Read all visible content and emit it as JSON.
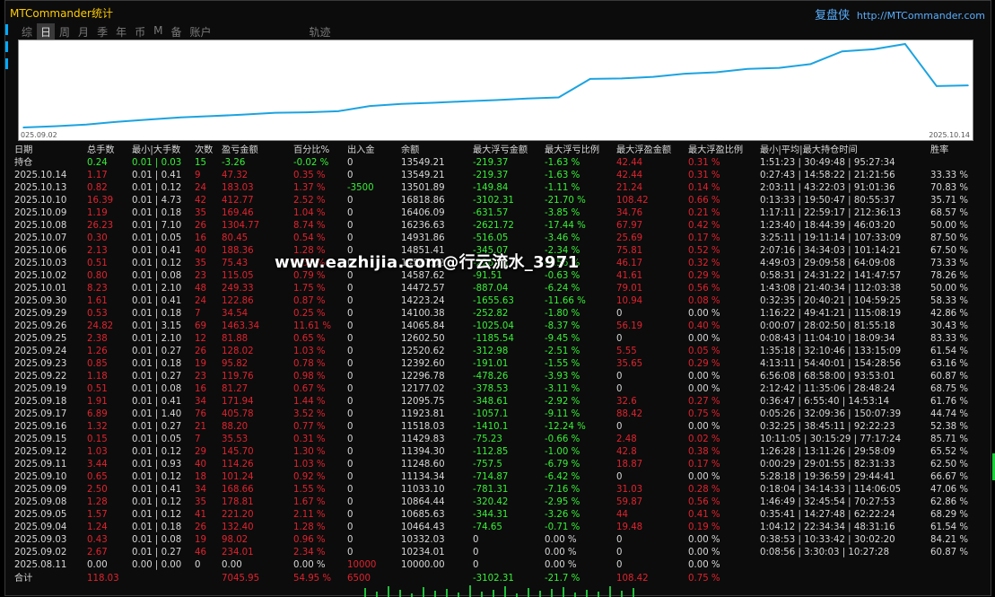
{
  "window": {
    "title": "MTCommander统计",
    "brand_cn": "复盘侠",
    "brand_url": "http://MTCommander.com"
  },
  "tabs": [
    "综",
    "日",
    "周",
    "月",
    "季",
    "年",
    "币",
    "M",
    "备",
    "账户",
    "轨迹"
  ],
  "active_tab": "日",
  "chart_data": {
    "type": "line",
    "x": [
      "2025.09.02",
      "2025.09.03",
      "2025.09.04",
      "2025.09.05",
      "2025.09.08",
      "2025.09.09",
      "2025.09.10",
      "2025.09.11",
      "2025.09.12",
      "2025.09.15",
      "2025.09.16",
      "2025.09.17",
      "2025.09.18",
      "2025.09.19",
      "2025.09.22",
      "2025.09.23",
      "2025.09.24",
      "2025.09.25",
      "2025.09.26",
      "2025.09.29",
      "2025.09.30",
      "2025.10.01",
      "2025.10.02",
      "2025.10.03",
      "2025.10.06",
      "2025.10.07",
      "2025.10.08",
      "2025.10.09",
      "2025.10.10",
      "2025.10.13",
      "2025.10.14"
    ],
    "series": [
      {
        "color": "#1ca3e0",
        "values": [
          10234.01,
          10332.03,
          10464.43,
          10685.63,
          10864.44,
          11033.1,
          11134.34,
          11248.6,
          11394.3,
          11429.83,
          11518.03,
          11923.81,
          12095.75,
          12177.02,
          12296.78,
          12392.6,
          12520.62,
          12602.5,
          14065.84,
          14100.38,
          14223.24,
          14472.57,
          14587.62,
          14851.41,
          14931.86,
          15236.63,
          16236.63,
          16406.09,
          16818.86,
          13501.89,
          13549.21
        ]
      }
    ],
    "x_start_label": "025.09.02",
    "x_end_label": "2025.10.14"
  },
  "table": {
    "headers": [
      "日期",
      "总手数",
      "最小|大手数",
      "次数",
      "盈亏金额",
      "百分比%",
      "出入金",
      "余额",
      "最大浮亏金额",
      "最大浮亏比例",
      "最大浮盈金额",
      "最大浮盈比例",
      "最小|平均|最大持仓时间",
      "胜率"
    ],
    "holding": [
      "持仓",
      "0.24",
      "0.01 | 0.03",
      "15",
      "-3.26",
      "-0.02 %",
      "0",
      "13549.21",
      "-219.37",
      "-1.63 %",
      "42.44",
      "0.31 %",
      "1:51:23 | 30:49:48 | 95:27:34",
      ""
    ],
    "rows": [
      [
        "2025.10.14",
        "1.17",
        "0.01 | 0.41",
        "9",
        "47.32",
        "0.35 %",
        "0",
        "13549.21",
        "-219.37",
        "-1.63 %",
        "42.44",
        "0.31 %",
        "0:27:43 | 14:58:22 | 21:21:56",
        "33.33 %"
      ],
      [
        "2025.10.13",
        "0.82",
        "0.01 | 0.12",
        "24",
        "183.03",
        "1.37 %",
        "-3500",
        "13501.89",
        "-149.84",
        "-1.11 %",
        "21.24",
        "0.14 %",
        "2:03:11 | 43:22:03 | 91:01:36",
        "70.83 %"
      ],
      [
        "2025.10.10",
        "16.39",
        "0.01 | 4.73",
        "42",
        "412.77",
        "2.52 %",
        "0",
        "16818.86",
        "-3102.31",
        "-21.70 %",
        "108.42",
        "0.66 %",
        "0:13:33 | 19:50:47 | 80:55:37",
        "35.71 %"
      ],
      [
        "2025.10.09",
        "1.19",
        "0.01 | 0.18",
        "35",
        "169.46",
        "1.04 %",
        "0",
        "16406.09",
        "-631.57",
        "-3.85 %",
        "34.76",
        "0.21 %",
        "1:17:11 | 22:59:17 | 212:36:13",
        "68.57 %"
      ],
      [
        "2025.10.08",
        "26.23",
        "0.01 | 7.10",
        "26",
        "1304.77",
        "8.74 %",
        "0",
        "16236.63",
        "-2621.72",
        "-17.44 %",
        "67.97",
        "0.42 %",
        "1:23:40 | 18:44:39 | 46:03:20",
        "50.00 %"
      ],
      [
        "2025.10.07",
        "0.30",
        "0.01 | 0.05",
        "16",
        "80.45",
        "0.54 %",
        "0",
        "14931.86",
        "-516.05",
        "-3.46 %",
        "25.69",
        "0.17 %",
        "3:25:11 | 19:11:14 | 107:33:09",
        "87.50 %"
      ],
      [
        "2025.10.06",
        "2.13",
        "0.01 | 0.41",
        "40",
        "188.36",
        "1.28 %",
        "0",
        "14851.41",
        "-345.07",
        "-2.34 %",
        "75.81",
        "0.52 %",
        "2:07:16 | 34:34:03 | 101:14:21",
        "67.50 %"
      ],
      [
        "2025.10.03",
        "0.51",
        "0.01 | 0.12",
        "35",
        "75.43",
        "0.52 %",
        "0",
        "14587.62",
        "-226.63",
        "-1.56 %",
        "46.17",
        "0.32 %",
        "4:49:03 | 29:09:58 | 64:09:08",
        "73.33 %"
      ],
      [
        "2025.10.02",
        "0.80",
        "0.01 | 0.08",
        "23",
        "115.05",
        "0.79 %",
        "0",
        "14587.62",
        "-91.51",
        "-0.63 %",
        "41.61",
        "0.29 %",
        "0:58:31 | 24:31:22 | 141:47:57",
        "78.26 %"
      ],
      [
        "2025.10.01",
        "8.23",
        "0.01 | 2.10",
        "48",
        "249.33",
        "1.75 %",
        "0",
        "14472.57",
        "-887.04",
        "-6.24 %",
        "79.01",
        "0.56 %",
        "1:43:08 | 21:40:34 | 112:03:38",
        "50.00 %"
      ],
      [
        "2025.09.30",
        "1.61",
        "0.01 | 0.41",
        "24",
        "122.86",
        "0.87 %",
        "0",
        "14223.24",
        "-1655.63",
        "-11.66 %",
        "10.94",
        "0.08 %",
        "0:32:35 | 20:40:21 | 104:59:25",
        "58.33 %"
      ],
      [
        "2025.09.29",
        "0.53",
        "0.01 | 0.18",
        "7",
        "34.54",
        "0.25 %",
        "0",
        "14100.38",
        "-252.82",
        "-1.80 %",
        "0",
        "0.00 %",
        "1:16:22 | 49:41:21 | 115:08:19",
        "42.86 %"
      ],
      [
        "2025.09.26",
        "24.82",
        "0.01 | 3.15",
        "69",
        "1463.34",
        "11.61 %",
        "0",
        "14065.84",
        "-1025.04",
        "-8.37 %",
        "56.19",
        "0.40 %",
        "0:00:07 | 28:02:50 | 81:55:18",
        "30.43 %"
      ],
      [
        "2025.09.25",
        "2.38",
        "0.01 | 2.10",
        "12",
        "81.88",
        "0.65 %",
        "0",
        "12602.50",
        "-1185.54",
        "-9.45 %",
        "0",
        "0.00 %",
        "0:08:43 | 11:04:10 | 18:09:34",
        "83.33 %"
      ],
      [
        "2025.09.24",
        "1.26",
        "0.01 | 0.27",
        "26",
        "128.02",
        "1.03 %",
        "0",
        "12520.62",
        "-312.98",
        "-2.51 %",
        "5.55",
        "0.05 %",
        "1:35:18 | 32:10:46 | 133:15:09",
        "61.54 %"
      ],
      [
        "2025.09.23",
        "0.85",
        "0.01 | 0.18",
        "19",
        "95.82",
        "0.78 %",
        "0",
        "12392.60",
        "-191.01",
        "-1.55 %",
        "35.65",
        "0.29 %",
        "4:13:11 | 54:40:01 | 154:28:56",
        "63.16 %"
      ],
      [
        "2025.09.22",
        "1.18",
        "0.01 | 0.27",
        "23",
        "119.76",
        "0.98 %",
        "0",
        "12296.78",
        "-478.26",
        "-3.93 %",
        "0",
        "0.00 %",
        "6:56:08 | 68:58:00 | 93:53:01",
        "60.87 %"
      ],
      [
        "2025.09.19",
        "0.51",
        "0.01 | 0.08",
        "16",
        "81.27",
        "0.67 %",
        "0",
        "12177.02",
        "-378.53",
        "-3.11 %",
        "0",
        "0.00 %",
        "2:12:42 | 11:35:06 | 28:48:24",
        "68.75 %"
      ],
      [
        "2025.09.18",
        "1.91",
        "0.01 | 0.41",
        "34",
        "171.94",
        "1.44 %",
        "0",
        "12095.75",
        "-348.61",
        "-2.92 %",
        "32.6",
        "0.27 %",
        "0:36:47 | 6:55:40 | 14:53:14",
        "61.76 %"
      ],
      [
        "2025.09.17",
        "6.89",
        "0.01 | 1.40",
        "76",
        "405.78",
        "3.52 %",
        "0",
        "11923.81",
        "-1057.1",
        "-9.11 %",
        "88.42",
        "0.75 %",
        "0:05:26 | 32:09:36 | 150:07:39",
        "44.74 %"
      ],
      [
        "2025.09.16",
        "1.32",
        "0.01 | 0.27",
        "21",
        "88.20",
        "0.77 %",
        "0",
        "11518.03",
        "-1410.1",
        "-12.24 %",
        "0",
        "0.00 %",
        "0:32:25 | 38:45:11 | 92:22:23",
        "52.38 %"
      ],
      [
        "2025.09.15",
        "0.15",
        "0.01 | 0.05",
        "7",
        "35.53",
        "0.31 %",
        "0",
        "11429.83",
        "-75.23",
        "-0.66 %",
        "2.48",
        "0.02 %",
        "10:11:05 | 30:15:29 | 77:17:24",
        "85.71 %"
      ],
      [
        "2025.09.12",
        "1.03",
        "0.01 | 0.12",
        "29",
        "145.70",
        "1.30 %",
        "0",
        "11394.30",
        "-112.85",
        "-1.00 %",
        "42.8",
        "0.38 %",
        "1:26:28 | 13:11:26 | 29:58:09",
        "65.52 %"
      ],
      [
        "2025.09.11",
        "3.44",
        "0.01 | 0.93",
        "40",
        "114.26",
        "1.03 %",
        "0",
        "11248.60",
        "-757.5",
        "-6.79 %",
        "18.87",
        "0.17 %",
        "0:00:29 | 29:01:55 | 82:31:33",
        "62.50 %"
      ],
      [
        "2025.09.10",
        "0.65",
        "0.01 | 0.12",
        "18",
        "101.24",
        "0.92 %",
        "0",
        "11134.34",
        "-714.87",
        "-6.42 %",
        "0",
        "0.00 %",
        "5:28:18 | 19:36:59 | 29:44:41",
        "66.67 %"
      ],
      [
        "2025.09.09",
        "2.50",
        "0.01 | 0.41",
        "34",
        "168.66",
        "1.55 %",
        "0",
        "11033.10",
        "-781.31",
        "-7.16 %",
        "31.03",
        "0.28 %",
        "0:18:04 | 34:14:33 | 114:06:05",
        "47.06 %"
      ],
      [
        "2025.09.08",
        "1.28",
        "0.01 | 0.12",
        "35",
        "178.81",
        "1.67 %",
        "0",
        "10864.44",
        "-320.42",
        "-2.95 %",
        "59.87",
        "0.56 %",
        "1:46:49 | 32:45:54 | 70:27:53",
        "62.86 %"
      ],
      [
        "2025.09.05",
        "1.57",
        "0.01 | 0.12",
        "41",
        "221.20",
        "2.11 %",
        "0",
        "10685.63",
        "-344.31",
        "-3.26 %",
        "44",
        "0.41 %",
        "0:35:41 | 14:27:48 | 62:22:24",
        "68.29 %"
      ],
      [
        "2025.09.04",
        "1.24",
        "0.01 | 0.18",
        "26",
        "132.40",
        "1.28 %",
        "0",
        "10464.43",
        "-74.65",
        "-0.71 %",
        "19.48",
        "0.19 %",
        "1:04:12 | 22:34:34 | 48:31:16",
        "61.54 %"
      ],
      [
        "2025.09.03",
        "0.43",
        "0.01 | 0.08",
        "19",
        "98.02",
        "0.96 %",
        "0",
        "10332.03",
        "0",
        "0.00 %",
        "0",
        "0.00 %",
        "0:38:53 | 10:33:42 | 30:02:20",
        "84.21 %"
      ],
      [
        "2025.09.02",
        "2.67",
        "0.01 | 0.27",
        "46",
        "234.01",
        "2.34 %",
        "0",
        "10234.01",
        "0",
        "0.00 %",
        "0",
        "0.00 %",
        "0:08:56 | 3:30:03 | 10:27:28",
        "60.87 %"
      ],
      [
        "2025.08.11",
        "0.00",
        "0.00 | 0.00",
        "0",
        "0.00",
        "0.00 %",
        "10000",
        "10000.00",
        "0",
        "0.00 %",
        "0",
        "0.00 %",
        "",
        ""
      ]
    ],
    "total": [
      "合计",
      "118.03",
      "",
      "",
      "7045.95",
      "54.95 %",
      "6500",
      "",
      "-3102.31",
      "-21.7 %",
      "108.42",
      "0.75 %",
      "",
      ""
    ]
  },
  "watermark": "www.eazhijia.com@行云流水_3971",
  "colors": {
    "loss": "#e0232f",
    "gain": "#38f038",
    "neutral": "#d8d8d8",
    "title": "#ffcc00",
    "link": "#5ab0ff",
    "line": "#1ca3e0"
  }
}
